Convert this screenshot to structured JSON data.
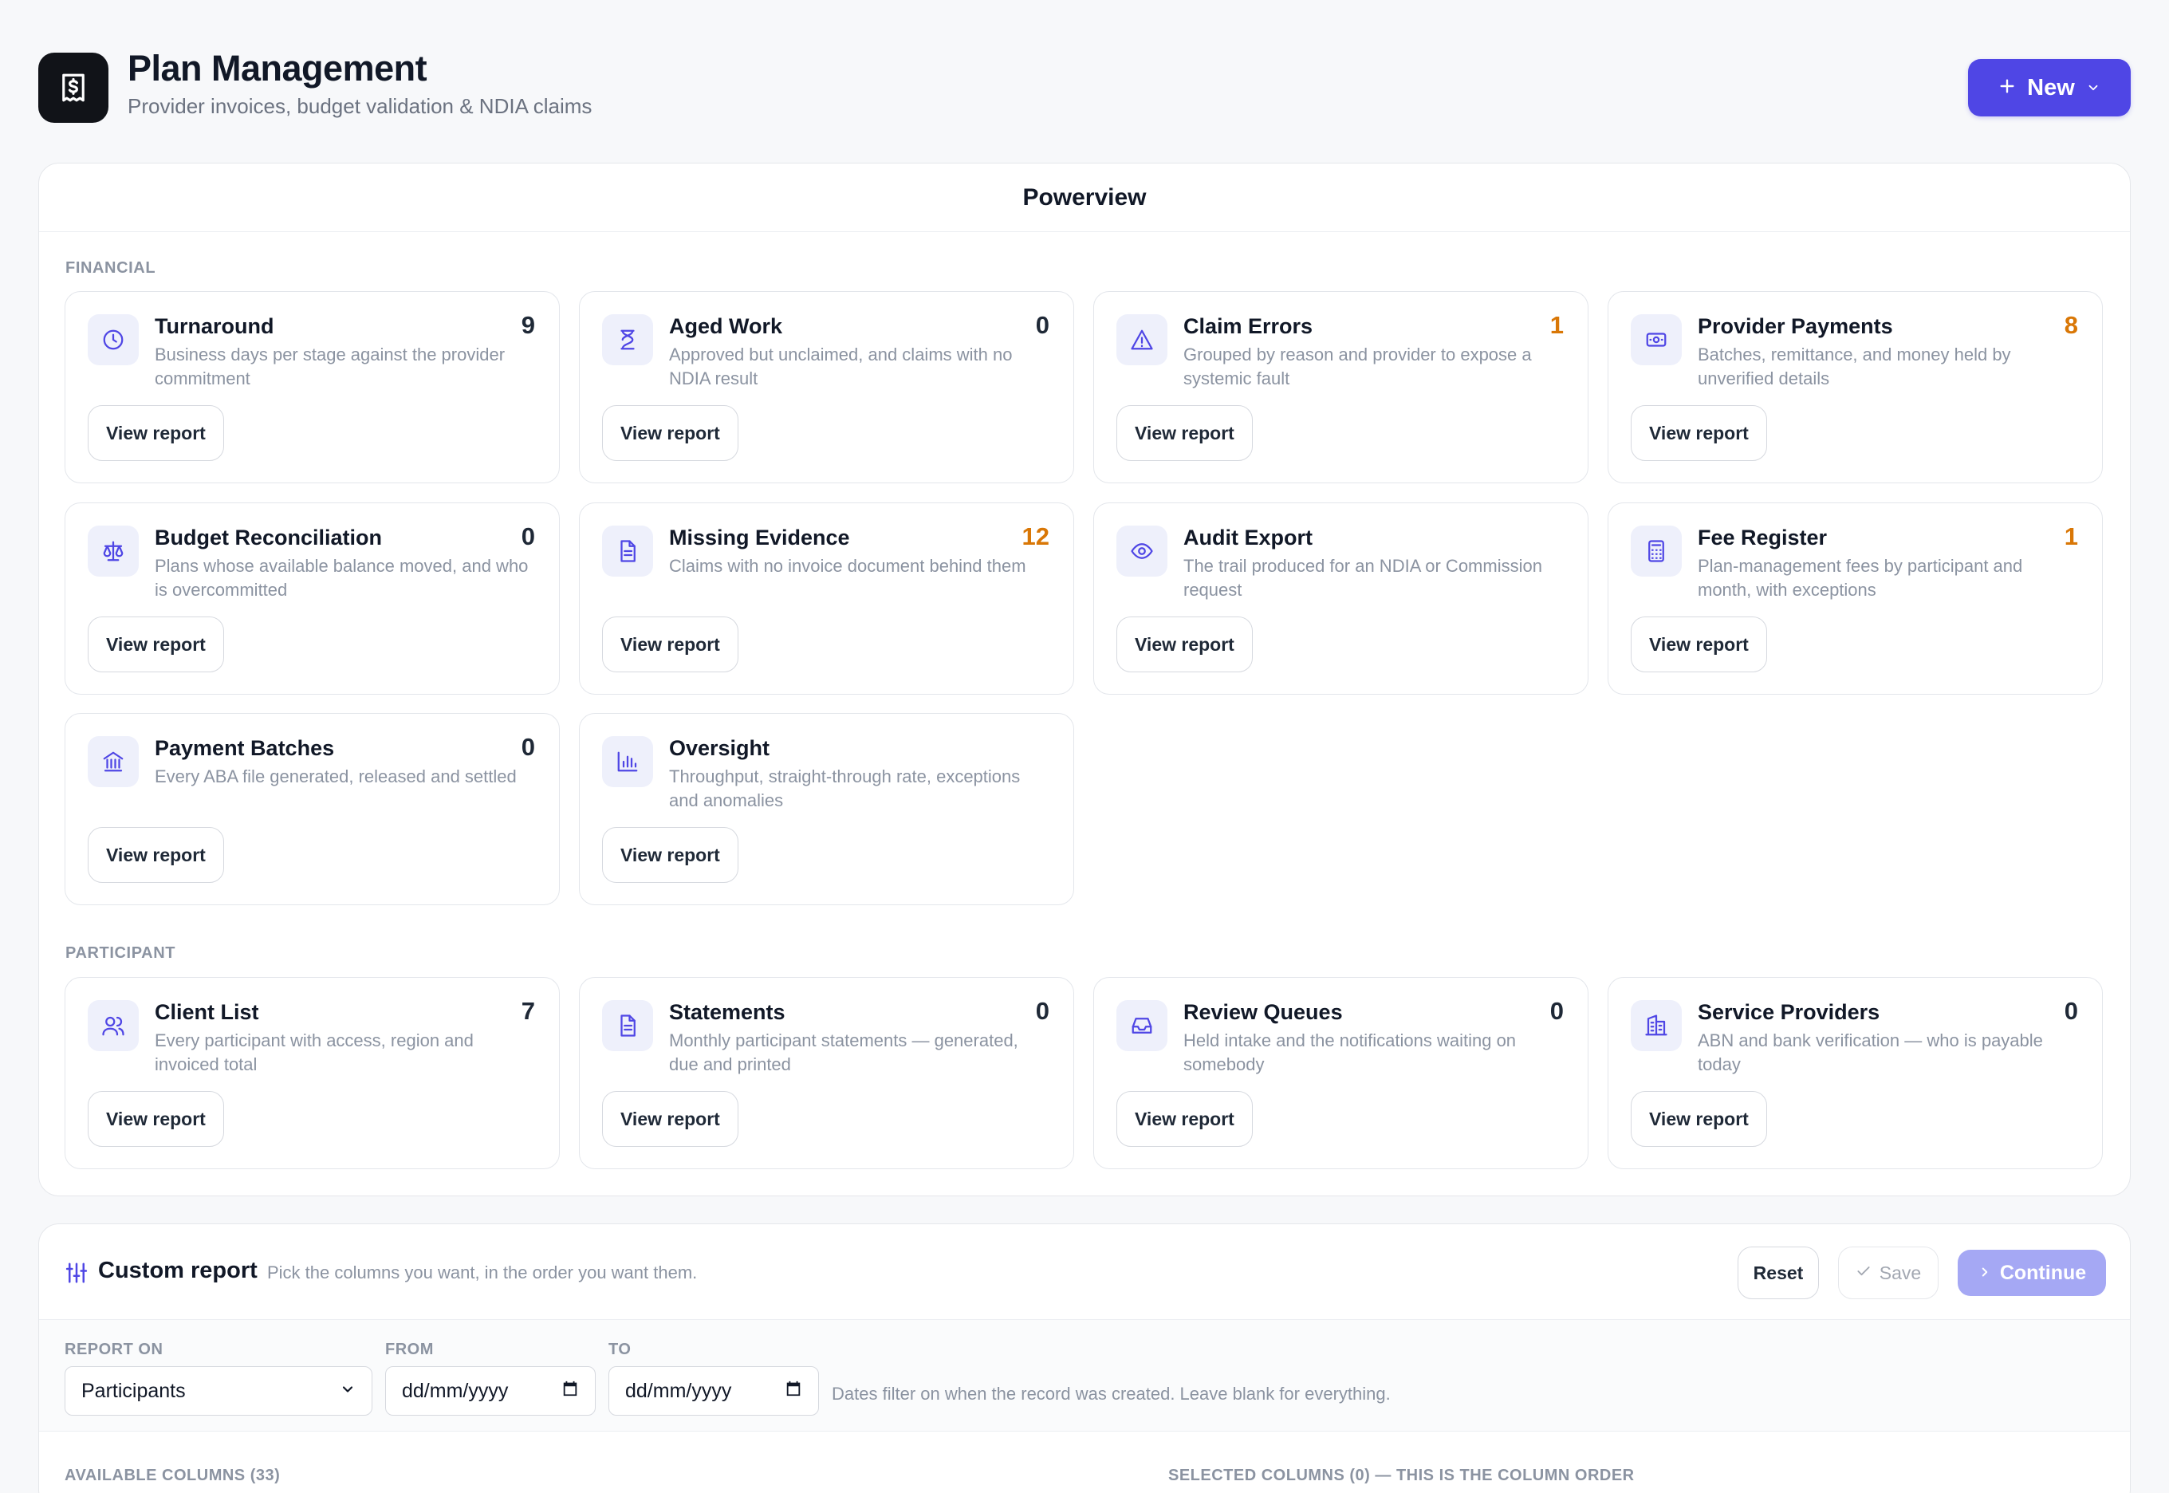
{
  "header": {
    "title": "Plan Management",
    "subtitle": "Provider invoices, budget validation & NDIA claims",
    "new_button": "New",
    "logo_icon": "dollar-receipt-icon"
  },
  "powerview": {
    "title": "Powerview",
    "sections": {
      "financial": "FINANCIAL",
      "participant": "PARTICIPANT"
    },
    "view_label": "View report",
    "cards": [
      {
        "title": "Turnaround",
        "count": "9",
        "desc": "Business days per stage against the provider commitment",
        "icon": "clock-icon"
      },
      {
        "title": "Aged Work",
        "count": "0",
        "desc": "Approved but unclaimed, and claims with no NDIA result",
        "icon": "hourglass-icon"
      },
      {
        "title": "Claim Errors",
        "count": "1",
        "desc": "Grouped by reason and provider to expose a systemic fault",
        "icon": "warning-icon"
      },
      {
        "title": "Provider Payments",
        "count": "8",
        "desc": "Batches, remittance, and money held by unverified details",
        "icon": "banknote-icon"
      },
      {
        "title": "Budget Reconciliation",
        "count": "0",
        "desc": "Plans whose available balance moved, and who is overcommitted",
        "icon": "scale-icon"
      },
      {
        "title": "Missing Evidence",
        "count": "12",
        "desc": "Claims with no invoice document behind them",
        "icon": "document-icon"
      },
      {
        "title": "Audit Export",
        "count": "",
        "desc": "The trail produced for an NDIA or Commission request",
        "icon": "eye-icon"
      },
      {
        "title": "Fee Register",
        "count": "1",
        "desc": "Plan-management fees by participant and month, with exceptions",
        "icon": "calculator-icon"
      },
      {
        "title": "Payment Batches",
        "count": "0",
        "desc": "Every ABA file generated, released and settled",
        "icon": "bank-icon"
      },
      {
        "title": "Oversight",
        "count": "",
        "desc": "Throughput, straight-through rate, exceptions and anomalies",
        "icon": "bar-chart-icon"
      },
      {
        "title": "Client List",
        "count": "7",
        "desc": "Every participant with access, region and invoiced total",
        "icon": "users-icon"
      },
      {
        "title": "Statements",
        "count": "0",
        "desc": "Monthly participant statements — generated, due and printed",
        "icon": "document-icon"
      },
      {
        "title": "Review Queues",
        "count": "0",
        "desc": "Held intake and the notifications waiting on somebody",
        "icon": "inbox-icon"
      },
      {
        "title": "Service Providers",
        "count": "0",
        "desc": "ABN and bank verification — who is payable today",
        "icon": "building-icon"
      }
    ]
  },
  "custom_report": {
    "title": "Custom report",
    "hint": "Pick the columns you want, in the order you want them.",
    "reset": "Reset",
    "save": "Save",
    "continue": "Continue",
    "report_on_label": "REPORT ON",
    "report_on_value": "Participants",
    "from_label": "FROM",
    "from_placeholder": "dd/mm/yyyy",
    "to_label": "TO",
    "to_placeholder": "dd/mm/yyyy",
    "dates_hint": "Dates filter on when the record was created. Leave blank for everything.",
    "available_columns": "AVAILABLE COLUMNS (33)",
    "selected_columns": "SELECTED COLUMNS (0) — THIS IS THE COLUMN ORDER"
  },
  "colors": {
    "accent": "#4f46e5",
    "warn": "#d97706",
    "icon": "#4f46e5"
  }
}
